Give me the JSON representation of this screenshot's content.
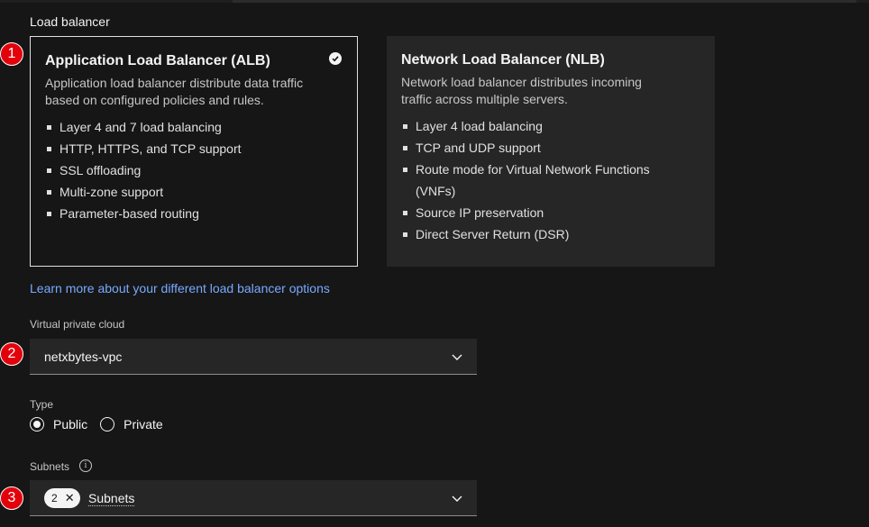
{
  "section_label": "Load balancer",
  "tiles": [
    {
      "title": "Application Load Balancer (ALB)",
      "description": "Application load balancer distribute data traffic based on configured policies and rules.",
      "selected": true,
      "features": [
        "Layer 4 and 7 load balancing",
        "HTTP, HTTPS, and TCP support",
        "SSL offloading",
        "Multi-zone support",
        "Parameter-based routing"
      ]
    },
    {
      "title": "Network Load Balancer (NLB)",
      "description": "Network load balancer distributes incoming traffic across multiple servers.",
      "selected": false,
      "features": [
        "Layer 4 load balancing",
        "TCP and UDP support",
        "Route mode for Virtual Network Functions (VNFs)",
        "Source IP preservation",
        "Direct Server Return (DSR)"
      ]
    }
  ],
  "learn_more_link": "Learn more about your different load balancer options",
  "vpc": {
    "label": "Virtual private cloud",
    "value": "netxbytes-vpc"
  },
  "type": {
    "label": "Type",
    "options": [
      "Public",
      "Private"
    ],
    "selected": "Public"
  },
  "subnets": {
    "label": "Subnets",
    "count": "2",
    "placeholder": "Subnets"
  },
  "markers": [
    "1",
    "2",
    "3"
  ],
  "colors": {
    "background": "#161616",
    "tile": "#262626",
    "link": "#78a9ff",
    "marker": "#e3000b"
  }
}
